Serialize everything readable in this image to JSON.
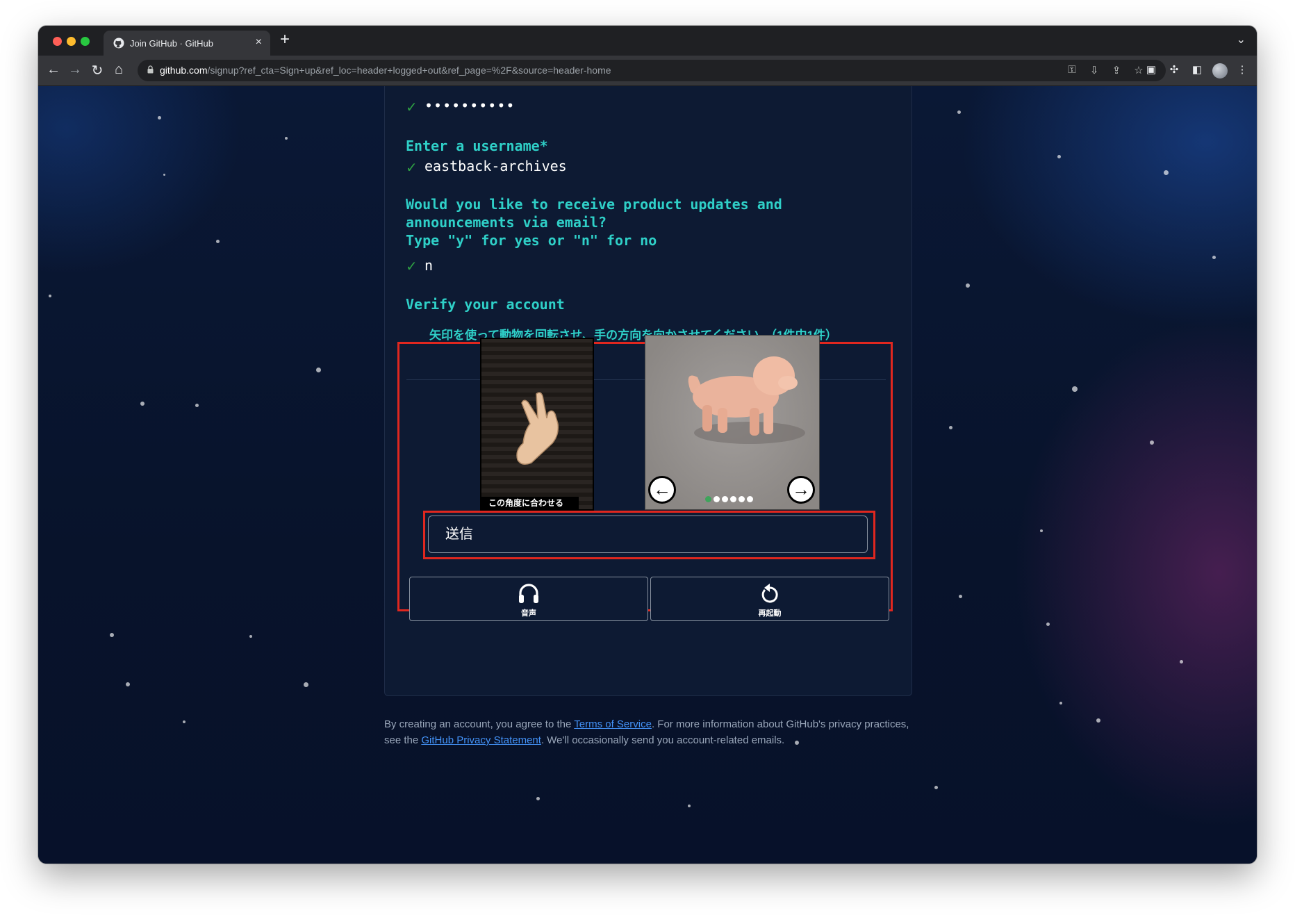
{
  "browser": {
    "tab_title": "Join GitHub · GitHub",
    "tab_close": "×",
    "new_tab": "+",
    "url_host": "github.com",
    "url_path": "/signup?ref_cta=Sign+up&ref_loc=header+logged+out&ref_page=%2F&source=header-home"
  },
  "signup": {
    "password_mask": "••••••••••",
    "username_prompt": "Enter a username*",
    "username_value": "eastback-archives",
    "email_prompt_1": "Would you like to receive product updates and",
    "email_prompt_2": "announcements via email?",
    "email_prompt_3": "Type \"y\" for yes or \"n\" for no",
    "email_value": "n",
    "check_mark": "✓"
  },
  "verify": {
    "title": "Verify your account",
    "instruction": "矢印を使って動物を回転させ、手の方向を向かさせてください。（1件中1件）",
    "hand_caption": "この角度に合わせる",
    "left_arrow": "←",
    "right_arrow": "→",
    "submit_label": "送信",
    "audio_label": "音声",
    "restart_label": "再起動",
    "dots_total": 6,
    "dots_active_index": 0
  },
  "footer": {
    "text_1": "By creating an account, you agree to the ",
    "terms_link": "Terms of Service",
    "text_2": ". For more information about GitHub's privacy practices, see the ",
    "privacy_link": "GitHub Privacy Statement",
    "text_3": ". We'll occasionally send you account-related emails."
  },
  "colors": {
    "prompt": "#2fd0c8",
    "check": "#2ea043",
    "highlight_border": "#e0271f",
    "link": "#4493f8"
  }
}
